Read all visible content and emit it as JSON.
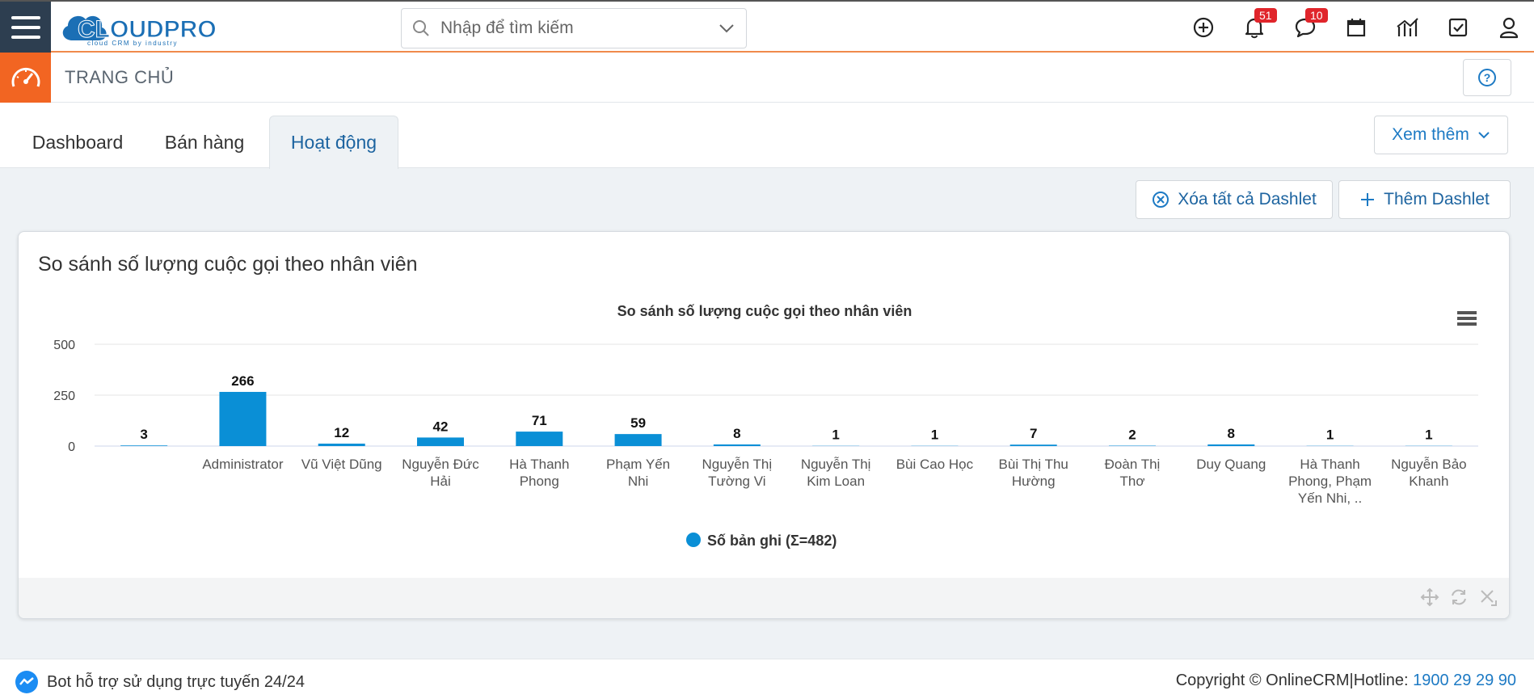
{
  "brand": {
    "name": "CLOUDPRO",
    "tagline": "cloud CRM by industry",
    "accent": "#f26522",
    "blue": "#1b6fb5"
  },
  "search": {
    "placeholder": "Nhập để tìm kiếm"
  },
  "notifications": {
    "bell_count": "51",
    "chat_count": "10"
  },
  "page": {
    "title": "TRANG CHỦ"
  },
  "tabs": [
    {
      "label": "Dashboard",
      "active": false
    },
    {
      "label": "Bán hàng",
      "active": false
    },
    {
      "label": "Hoạt động",
      "active": true
    }
  ],
  "more_label": "Xem thêm",
  "actions": {
    "clear_all": "Xóa tất cả Dashlet",
    "add": "Thêm Dashlet"
  },
  "dashlet": {
    "title": "So sánh số lượng cuộc gọi theo nhân viên"
  },
  "chart_data": {
    "type": "bar",
    "title": "So sánh số lượng cuộc gọi theo nhân viên",
    "categories": [
      "",
      "Administrator",
      "Vũ Việt Dũng",
      "Nguyễn Đức Hải",
      "Hà Thanh Phong",
      "Phạm Yến Nhi",
      "Nguyễn Thị Tường Vi",
      "Nguyễn Thị Kim Loan",
      "Bùi Cao Học",
      "Bùi Thị Thu Hường",
      "Đoàn Thị Thơ",
      "Duy Quang",
      "Hà Thanh Phong, Phạm Yến Nhi, ..",
      "Nguyễn Bảo Khanh"
    ],
    "category_lines": [
      [
        ""
      ],
      [
        "Administrator"
      ],
      [
        "Vũ Việt Dũng"
      ],
      [
        "Nguyễn Đức",
        "Hải"
      ],
      [
        "Hà Thanh",
        "Phong"
      ],
      [
        "Phạm Yến",
        "Nhi"
      ],
      [
        "Nguyễn Thị",
        "Tường Vi"
      ],
      [
        "Nguyễn Thị",
        "Kim Loan"
      ],
      [
        "Bùi Cao Học"
      ],
      [
        "Bùi Thị Thu",
        "Hường"
      ],
      [
        "Đoàn Thị",
        "Thơ"
      ],
      [
        "Duy Quang"
      ],
      [
        "Hà Thanh",
        "Phong, Phạm",
        "Yến Nhi, .."
      ],
      [
        "Nguyễn Bảo",
        "Khanh"
      ]
    ],
    "series": [
      {
        "name": "Số bản ghi (Σ=482)",
        "color": "#0a8fd6",
        "values": [
          3,
          266,
          12,
          42,
          71,
          59,
          8,
          1,
          1,
          7,
          2,
          8,
          1,
          1
        ]
      }
    ],
    "yticks": [
      0,
      250,
      500
    ],
    "ylim": [
      0,
      500
    ],
    "grid": true,
    "legend": "bottom-center"
  },
  "footer": {
    "bot_text": "Bot hỗ trợ sử dụng trực tuyến 24/24",
    "copyright": "Copyright © OnlineCRM|Hotline: ",
    "hotline": "1900 29 29 90"
  }
}
